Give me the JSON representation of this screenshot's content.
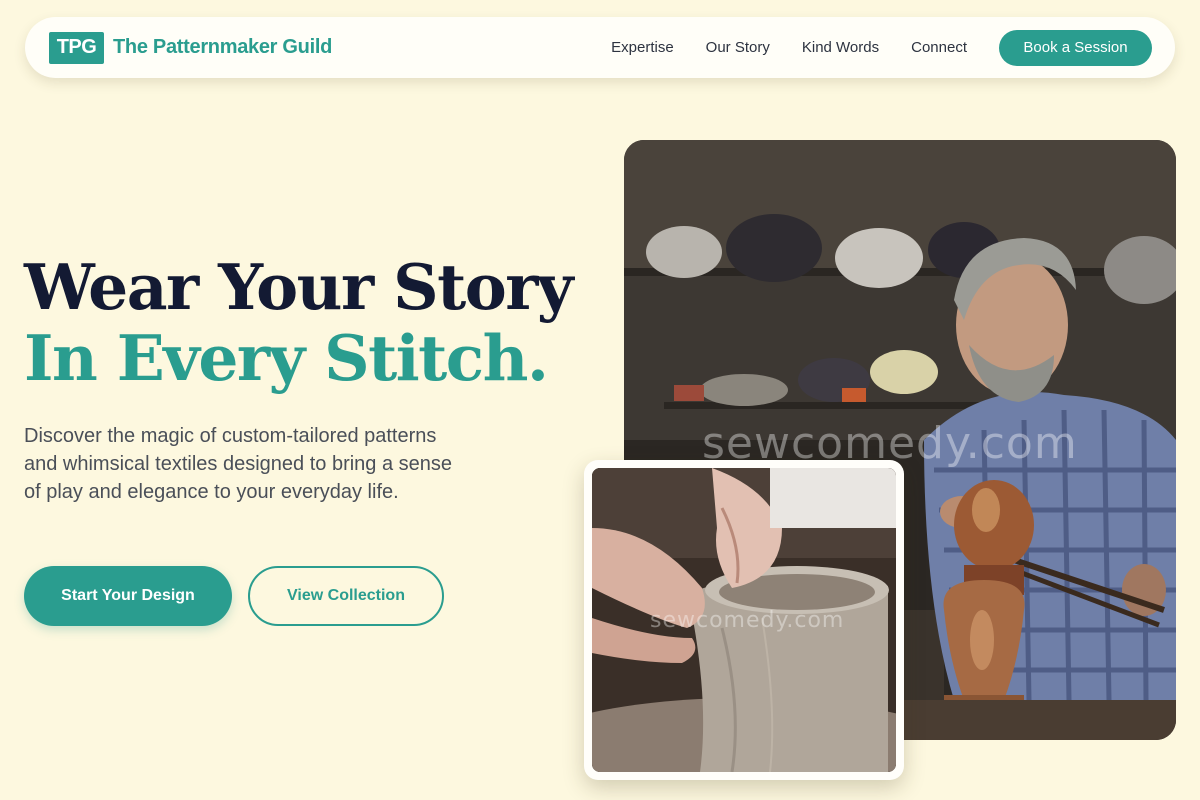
{
  "brand": {
    "badge": "TPG",
    "name": "The Patternmaker Guild",
    "color": "#2a9d8f"
  },
  "nav": {
    "links": [
      "Expertise",
      "Our Story",
      "Kind Words",
      "Connect"
    ],
    "cta": "Book a Session"
  },
  "hero": {
    "headline_line1": "Wear Your Story",
    "headline_line2": "In Every Stitch.",
    "description": "Discover the magic of custom-tailored patterns and whimsical textiles designed to bring a sense of play and elegance to your everyday life.",
    "primary_button": "Start Your Design",
    "secondary_button": "View Collection"
  },
  "images": {
    "main_watermark": "sewcomedy.com",
    "small_watermark": "sewcomedy.com"
  },
  "colors": {
    "background": "#fdf8df",
    "heading_dark": "#131a33",
    "accent": "#2a9d8f",
    "body_text": "#4a4f58"
  }
}
